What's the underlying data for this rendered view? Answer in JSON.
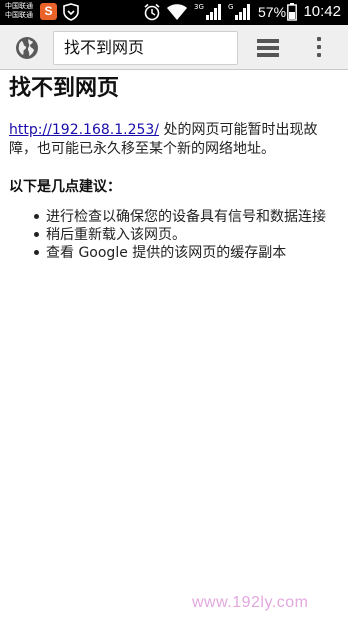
{
  "status_bar": {
    "carrier_1": "中国联通",
    "carrier_2": "中国联通",
    "app_badge": "S",
    "net_1": "3G",
    "net_2": "G",
    "battery_percent": "57%",
    "time": "10:42",
    "icons": [
      "app-s-icon",
      "shield-icon",
      "alarm-icon",
      "wifi-icon",
      "signal-icon",
      "signal-icon",
      "battery-icon"
    ]
  },
  "toolbar": {
    "omnibox_text": "找不到网页",
    "icons": [
      "globe-icon",
      "tabs-icon",
      "overflow-menu-icon"
    ]
  },
  "page": {
    "title": "找不到网页",
    "url_link": "http://192.168.1.253/",
    "description": " 处的网页可能暂时出现故障，也可能已永久移至某个新的网络地址。",
    "suggestions_heading": "以下是几点建议：",
    "suggestions": [
      "进行检查以确保您的设备具有信号和数据连接",
      "稍后重新载入该网页。",
      "查看 Google 提供的该网页的缓存副本"
    ]
  },
  "watermark": "www.192ly.com",
  "colors": {
    "status_bar": "#000000",
    "toolbar": "#efefef",
    "link": "#1a0dab",
    "watermark": "#e2a8df"
  }
}
